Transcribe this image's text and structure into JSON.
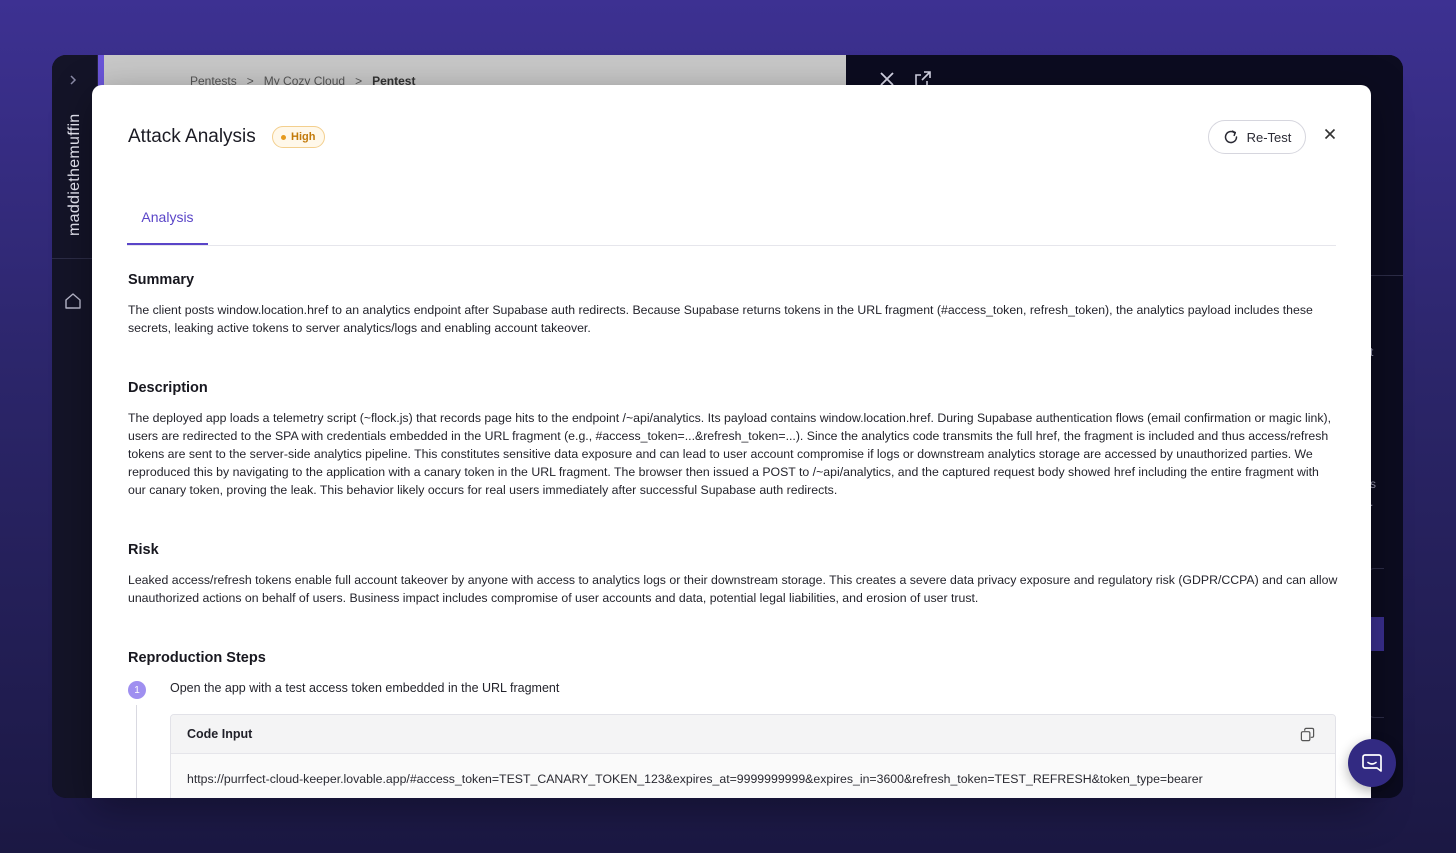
{
  "sidebar": {
    "username": "maddiethemuffin"
  },
  "background": {
    "breadcrumbs": [
      "Pentests",
      ">",
      "My Cozy Cloud",
      ">",
      "Pentest"
    ],
    "fragments": [
      "o",
      "ct",
      "ss",
      "s."
    ]
  },
  "modal": {
    "title": "Attack Analysis",
    "severity": "High",
    "retest_label": "Re-Test",
    "tab_analysis": "Analysis",
    "summary_title": "Summary",
    "summary_text": "The client posts window.location.href to an analytics endpoint after Supabase auth redirects. Because Supabase returns tokens in the URL fragment (#access_token, refresh_token), the analytics payload includes these secrets, leaking active tokens to server analytics/logs and enabling account takeover.",
    "description_title": "Description",
    "description_text": "The deployed app loads a telemetry script (~flock.js) that records page hits to the endpoint /~api/analytics. Its payload contains window.location.href. During Supabase authentication flows (email confirmation or magic link), users are redirected to the SPA with credentials embedded in the URL fragment (e.g., #access_token=...&refresh_token=...). Since the analytics code transmits the full href, the fragment is included and thus access/refresh tokens are sent to the server-side analytics pipeline. This constitutes sensitive data exposure and can lead to user account compromise if logs or downstream analytics storage are accessed by unauthorized parties. We reproduced this by navigating to the application with a canary token in the URL fragment. The browser then issued a POST to /~api/analytics, and the captured request body showed href including the entire fragment with our canary token, proving the leak. This behavior likely occurs for real users immediately after successful Supabase auth redirects.",
    "risk_title": "Risk",
    "risk_text": "Leaked access/refresh tokens enable full account takeover by anyone with access to analytics logs or their downstream storage. This creates a severe data privacy exposure and regulatory risk (GDPR/CCPA) and can allow unauthorized actions on behalf of users. Business impact includes compromise of user accounts and data, potential legal liabilities, and erosion of user trust.",
    "repro_title": "Reproduction Steps",
    "steps": [
      {
        "number": "1",
        "text": "Open the app with a test access token embedded in the URL fragment",
        "code_label": "Code Input",
        "code": "https://purrfect-cloud-keeper.lovable.app/#access_token=TEST_CANARY_TOKEN_123&expires_at=9999999999&expires_in=3600&refresh_token=TEST_REFRESH&token_type=bearer"
      }
    ]
  },
  "colors": {
    "accent": "#5a45c8",
    "severity_high": "#c27a0a",
    "chat_bubble": "#322a82"
  }
}
